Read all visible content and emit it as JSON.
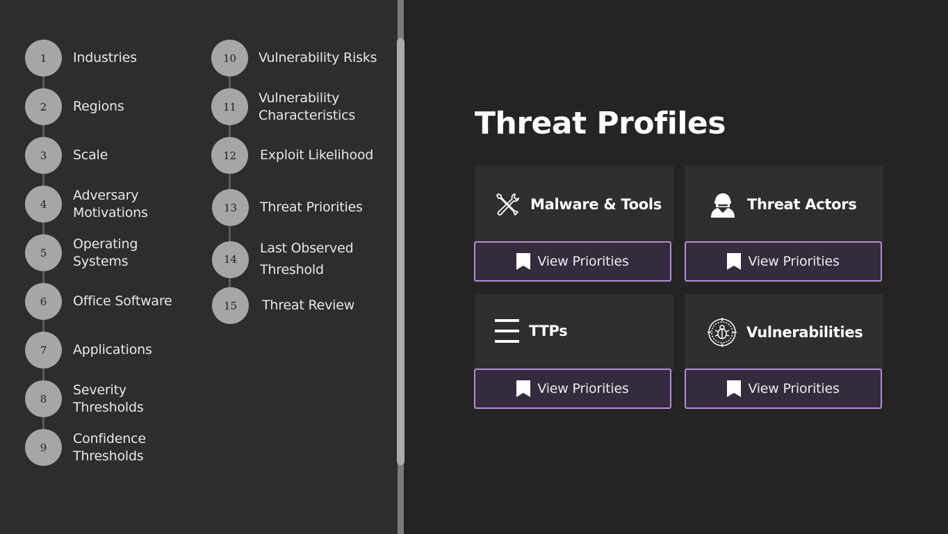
{
  "sidebar": {
    "steps": [
      {
        "number": "1",
        "label": "Industries"
      },
      {
        "number": "2",
        "label": "Regions"
      },
      {
        "number": "3",
        "label": "Scale"
      },
      {
        "number": "4",
        "label": "Adversary\nMotivations"
      },
      {
        "number": "5",
        "label": "Operating\nSystems"
      },
      {
        "number": "6",
        "label": "Office Software"
      },
      {
        "number": "7",
        "label": "Applications"
      },
      {
        "number": "8",
        "label": "Severity\nThresholds"
      },
      {
        "number": "9",
        "label": "Confidence\nThresholds"
      },
      {
        "number": "10",
        "label": "Vulnerability Risks"
      },
      {
        "number": "11",
        "label": "Vulnerability\nCharacteristics"
      },
      {
        "number": "12",
        "label": "Exploit Likelihood"
      },
      {
        "number": "13",
        "label": "Threat Priorities"
      },
      {
        "number": "14",
        "label": "Last Observed\nThreshold"
      },
      {
        "number": "15",
        "label": "Threat Review"
      }
    ]
  },
  "main": {
    "title": "Threat Profiles",
    "cards": [
      {
        "title": "Malware & Tools",
        "icon": "tools-icon",
        "button_label": "View Priorities"
      },
      {
        "title": "Threat Actors",
        "icon": "hacker-icon",
        "button_label": "View Priorities"
      },
      {
        "title": "TTPs",
        "icon": "list-icon",
        "button_label": "View Priorities"
      },
      {
        "title": "Vulnerabilities",
        "icon": "bug-target-icon",
        "button_label": "View Priorities"
      }
    ]
  },
  "colors": {
    "accent_border": "#b58ed3",
    "button_bg": "#352b3e",
    "step_circle": "#a6a6a6"
  }
}
